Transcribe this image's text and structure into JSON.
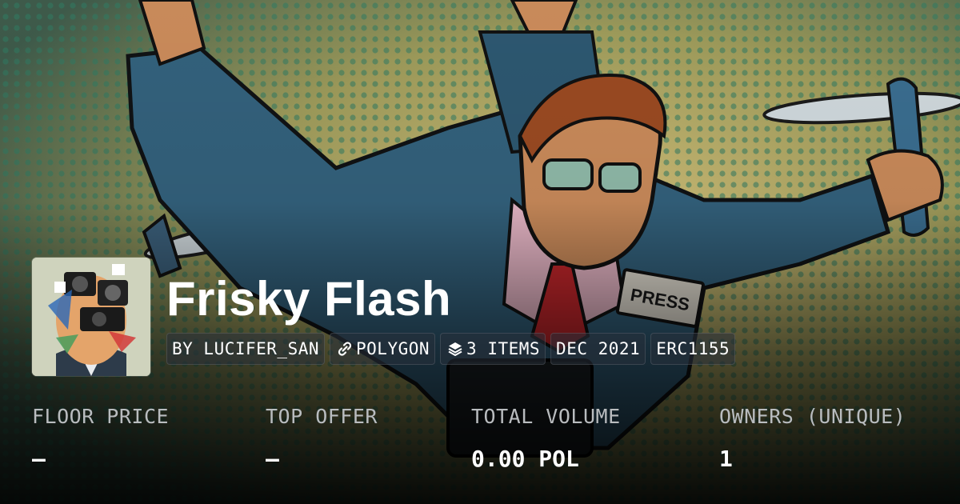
{
  "collection": {
    "name": "Frisky Flash",
    "tags": {
      "creator": "BY LUCIFER_SAN",
      "chain": "POLYGON",
      "items": "3 ITEMS",
      "date": "DEC 2021",
      "standard": "ERC1155"
    },
    "icons": {
      "chain": "link-icon",
      "items": "layers-icon"
    }
  },
  "stats": {
    "floor_price": {
      "label": "FLOOR PRICE",
      "value": "–"
    },
    "top_offer": {
      "label": "TOP OFFER",
      "value": "–"
    },
    "total_volume": {
      "label": "TOTAL VOLUME",
      "value": "0.00 POL"
    },
    "owners": {
      "label": "OWNERS (UNIQUE)",
      "value": "1"
    }
  },
  "colors": {
    "text": "#ffffff",
    "label": "#b9bcbf",
    "tag_bg": "#28303a"
  }
}
